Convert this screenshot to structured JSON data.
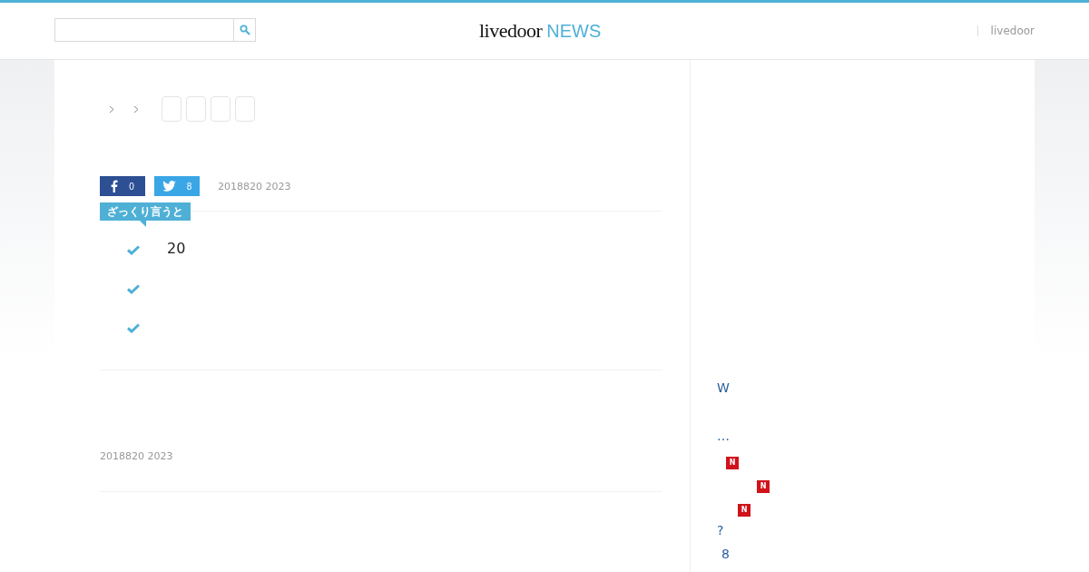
{
  "header": {
    "logo": {
      "brand": "livedoor",
      "product": "NEWS"
    },
    "nav": [
      "livedoor"
    ]
  },
  "article": {
    "share": {
      "facebook_count": "0",
      "twitter_count": "8"
    },
    "date": "2018820 2023",
    "summary": {
      "label": "ざっくり言うと",
      "points": [
        {
          "kind": "text",
          "text": "20"
        },
        {
          "kind": "blank"
        },
        {
          "kind": "blank"
        }
      ]
    },
    "footer_date": "2018820 2023"
  },
  "sidebar": {
    "items": [
      {
        "kind": "link",
        "text": "W"
      },
      {
        "kind": "link",
        "text": "…"
      },
      {
        "kind": "badge",
        "text": "N"
      },
      {
        "kind": "badge",
        "text": "N"
      },
      {
        "kind": "badge",
        "text": "N"
      },
      {
        "kind": "link",
        "text": "?"
      },
      {
        "kind": "link",
        "text": "8"
      }
    ]
  }
}
